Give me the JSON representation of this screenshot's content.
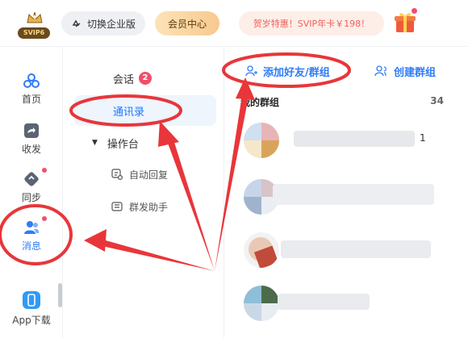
{
  "header": {
    "logo_label": "SVIP6",
    "switch_label": "切换企业版",
    "vip_center_label": "会员中心",
    "promo_text": "贺岁特惠！SVIP年卡￥198！"
  },
  "rail": {
    "items": [
      {
        "label": "首页",
        "icon": "home-icon"
      },
      {
        "label": "收发",
        "icon": "share-icon"
      },
      {
        "label": "同步",
        "icon": "sync-icon"
      },
      {
        "label": "消息",
        "icon": "contacts-icon"
      },
      {
        "label": "App下载",
        "icon": "mobile-icon"
      }
    ]
  },
  "mid": {
    "session_label": "会话",
    "session_badge": "2",
    "contacts_label": "通讯录",
    "console_label": "操作台",
    "auto_reply_label": "自动回复",
    "broadcast_label": "群发助手"
  },
  "right": {
    "add_label": "添加好友/群组",
    "create_label": "创建群组",
    "group_title": "我的群组",
    "group_count": "34",
    "first_suffix": "1"
  },
  "colors": {
    "accent": "#2f7cf6",
    "annotation": "#e8363a",
    "badge": "#f04e6a"
  }
}
